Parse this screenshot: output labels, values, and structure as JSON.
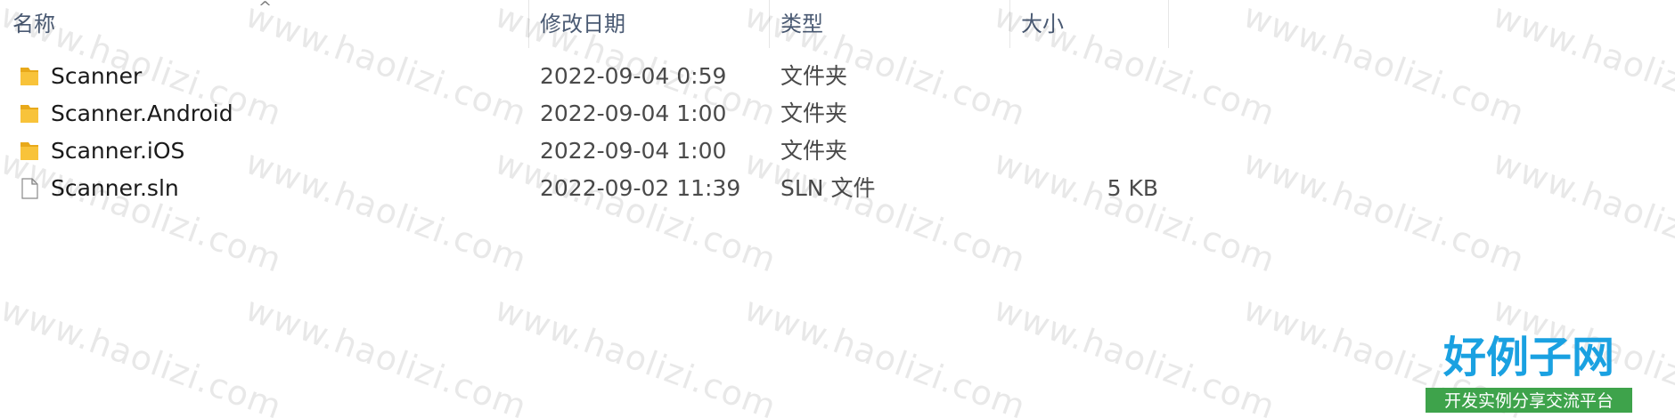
{
  "columns": {
    "name": "名称",
    "date": "修改日期",
    "type": "类型",
    "size": "大小"
  },
  "files": [
    {
      "name": "Scanner",
      "date": "2022-09-04 0:59",
      "type": "文件夹",
      "size": "",
      "icon": "folder-icon"
    },
    {
      "name": "Scanner.Android",
      "date": "2022-09-04 1:00",
      "type": "文件夹",
      "size": "",
      "icon": "folder-icon"
    },
    {
      "name": "Scanner.iOS",
      "date": "2022-09-04 1:00",
      "type": "文件夹",
      "size": "",
      "icon": "folder-icon"
    },
    {
      "name": "Scanner.sln",
      "date": "2022-09-02 11:39",
      "type": "SLN 文件",
      "size": "5 KB",
      "icon": "file-icon"
    }
  ],
  "watermark": {
    "text": "www.haolizi.com",
    "logo_title": "好例子网",
    "logo_subtitle": "开发实例分享交流平台"
  },
  "colors": {
    "folder": "#f8c33a",
    "folder_dark": "#e8a91a",
    "logo_blue": "#1aa1e1",
    "logo_green": "#3ea34b"
  }
}
